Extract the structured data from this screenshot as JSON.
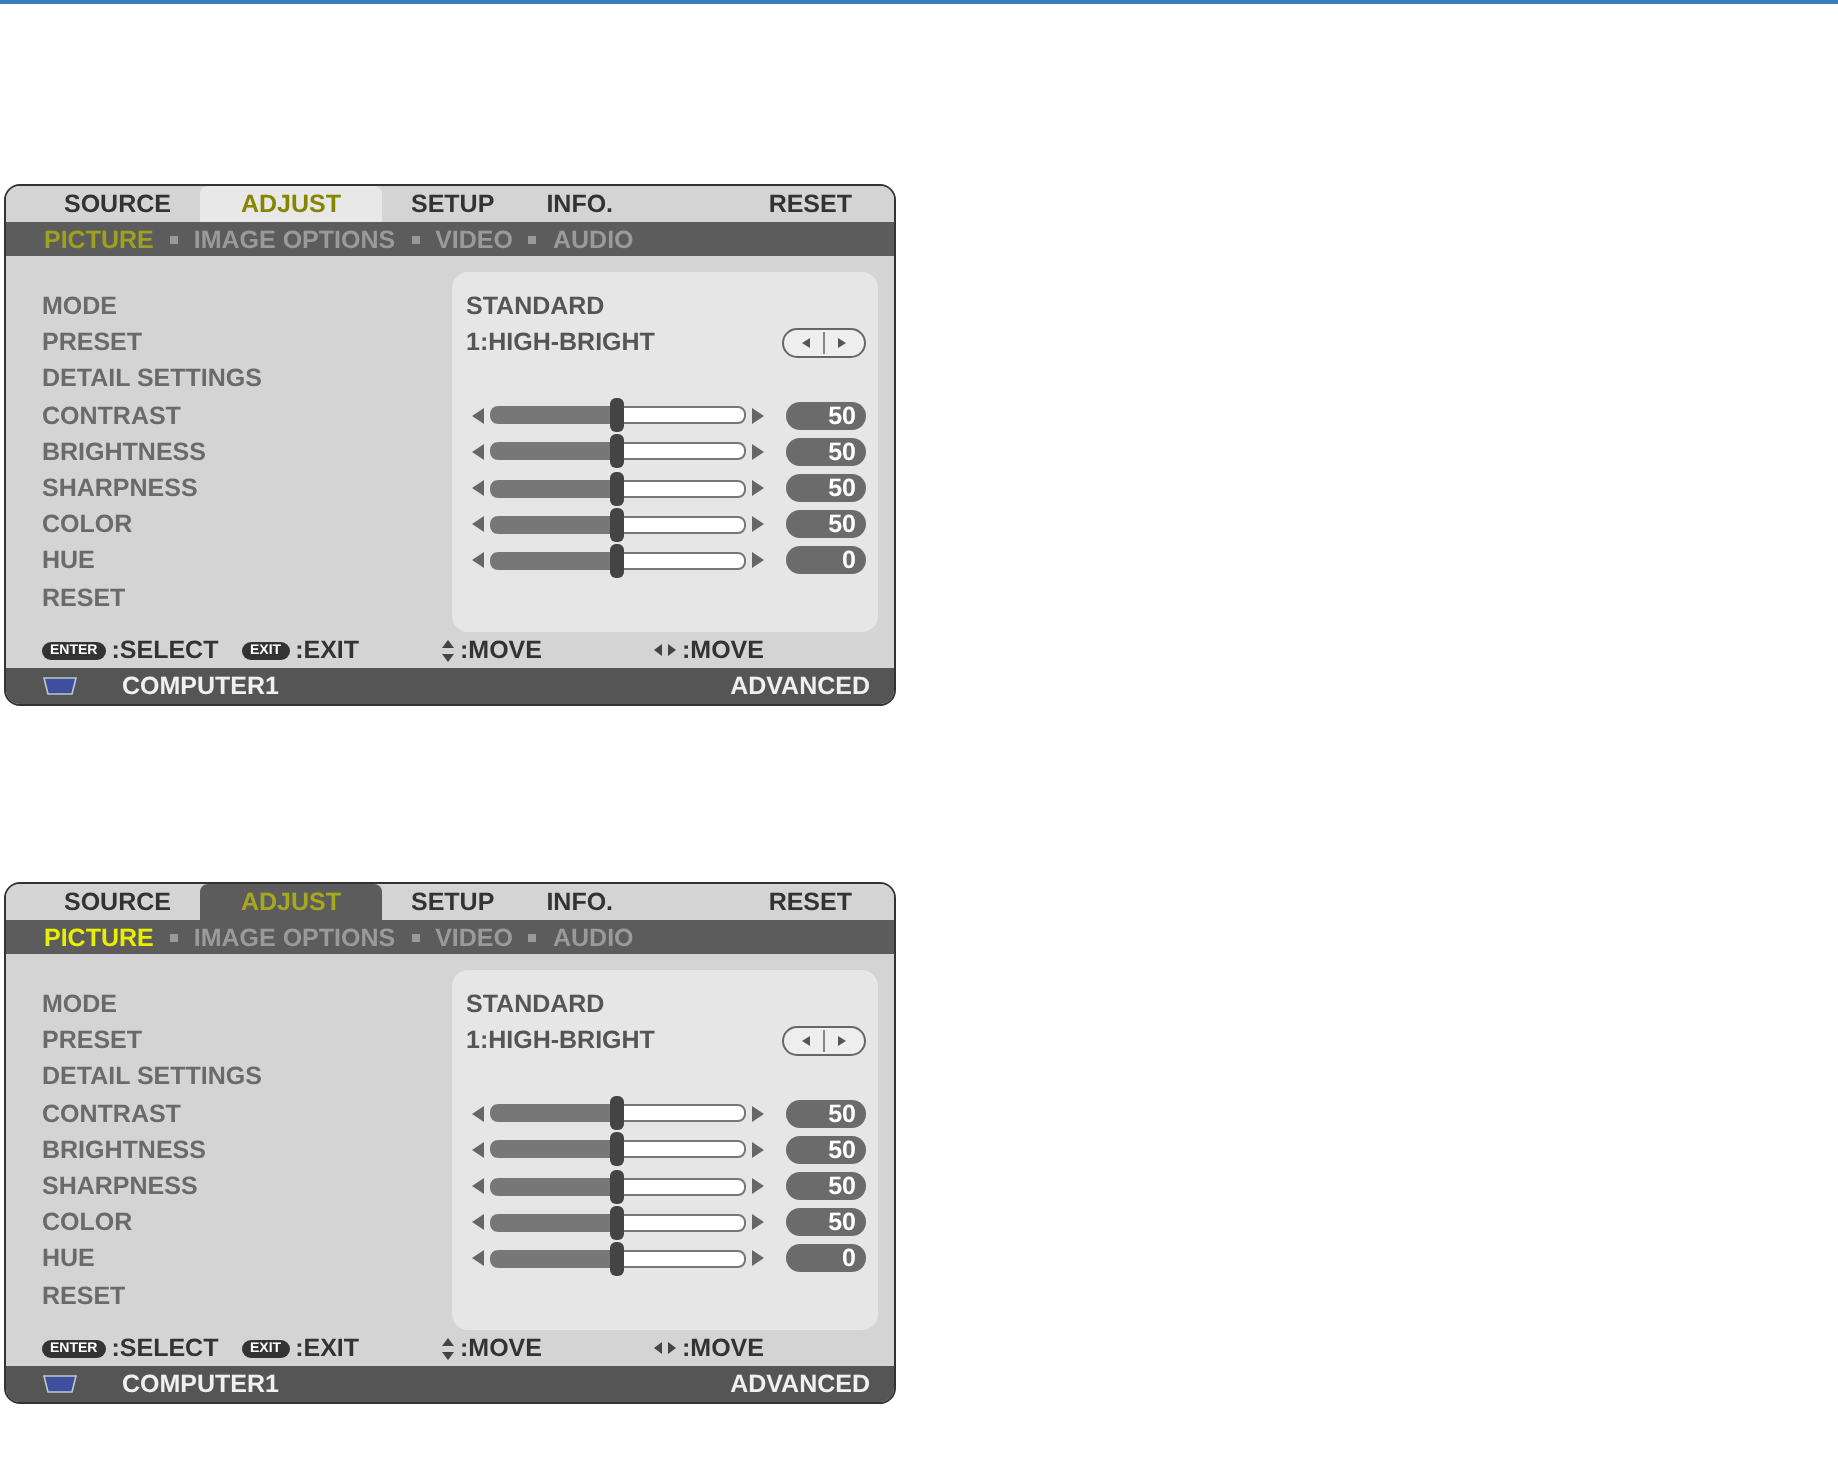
{
  "menus": [
    {
      "tabs_focused": true,
      "tabs": [
        {
          "label": "SOURCE",
          "selected": false
        },
        {
          "label": "ADJUST",
          "selected": true
        },
        {
          "label": "SETUP",
          "selected": false
        },
        {
          "label": "INFO.",
          "selected": false
        },
        {
          "label": "RESET",
          "selected": false
        }
      ],
      "subtabs": [
        {
          "label": "PICTURE",
          "selected": true
        },
        {
          "label": "IMAGE OPTIONS",
          "selected": false
        },
        {
          "label": "VIDEO",
          "selected": false
        },
        {
          "label": "AUDIO",
          "selected": false
        }
      ],
      "rows": [
        {
          "kind": "text",
          "label": "MODE",
          "value": "STANDARD"
        },
        {
          "kind": "preset",
          "label": "PRESET",
          "value": "1:HIGH-BRIGHT"
        },
        {
          "kind": "label",
          "label": "DETAIL SETTINGS"
        },
        {
          "kind": "slider",
          "label": "CONTRAST",
          "level": 0.5,
          "reading": "50"
        },
        {
          "kind": "slider",
          "label": "BRIGHTNESS",
          "level": 0.5,
          "reading": "50"
        },
        {
          "kind": "slider",
          "label": "SHARPNESS",
          "level": 0.5,
          "reading": "50"
        },
        {
          "kind": "slider",
          "label": "COLOR",
          "level": 0.5,
          "reading": "50"
        },
        {
          "kind": "slider",
          "label": "HUE",
          "level": 0.5,
          "reading": "0"
        },
        {
          "kind": "label",
          "label": "RESET"
        }
      ],
      "hints": [
        {
          "kind": "key",
          "key": "ENTER",
          "text": ":SELECT"
        },
        {
          "kind": "key",
          "key": "EXIT",
          "text": ":EXIT"
        },
        {
          "kind": "updown",
          "text": ":MOVE"
        },
        {
          "kind": "leftright",
          "text": ":MOVE"
        }
      ],
      "status": {
        "source": "COMPUTER1",
        "mode": "ADVANCED"
      }
    },
    {
      "tabs_focused": false,
      "tabs": [
        {
          "label": "SOURCE",
          "selected": false
        },
        {
          "label": "ADJUST",
          "selected": true
        },
        {
          "label": "SETUP",
          "selected": false
        },
        {
          "label": "INFO.",
          "selected": false
        },
        {
          "label": "RESET",
          "selected": false
        }
      ],
      "subtabs": [
        {
          "label": "PICTURE",
          "selected": true
        },
        {
          "label": "IMAGE OPTIONS",
          "selected": false
        },
        {
          "label": "VIDEO",
          "selected": false
        },
        {
          "label": "AUDIO",
          "selected": false
        }
      ],
      "rows": [
        {
          "kind": "text",
          "label": "MODE",
          "value": "STANDARD"
        },
        {
          "kind": "preset",
          "label": "PRESET",
          "value": "1:HIGH-BRIGHT"
        },
        {
          "kind": "label",
          "label": "DETAIL SETTINGS"
        },
        {
          "kind": "slider",
          "label": "CONTRAST",
          "level": 0.5,
          "reading": "50"
        },
        {
          "kind": "slider",
          "label": "BRIGHTNESS",
          "level": 0.5,
          "reading": "50"
        },
        {
          "kind": "slider",
          "label": "SHARPNESS",
          "level": 0.5,
          "reading": "50"
        },
        {
          "kind": "slider",
          "label": "COLOR",
          "level": 0.5,
          "reading": "50"
        },
        {
          "kind": "slider",
          "label": "HUE",
          "level": 0.5,
          "reading": "0"
        },
        {
          "kind": "label",
          "label": "RESET"
        }
      ],
      "hints": [
        {
          "kind": "key",
          "key": "ENTER",
          "text": ":SELECT"
        },
        {
          "kind": "key",
          "key": "EXIT",
          "text": ":EXIT"
        },
        {
          "kind": "updown",
          "text": ":MOVE"
        },
        {
          "kind": "leftright",
          "text": ":MOVE"
        }
      ],
      "status": {
        "source": "COMPUTER1",
        "mode": "ADVANCED"
      }
    }
  ]
}
